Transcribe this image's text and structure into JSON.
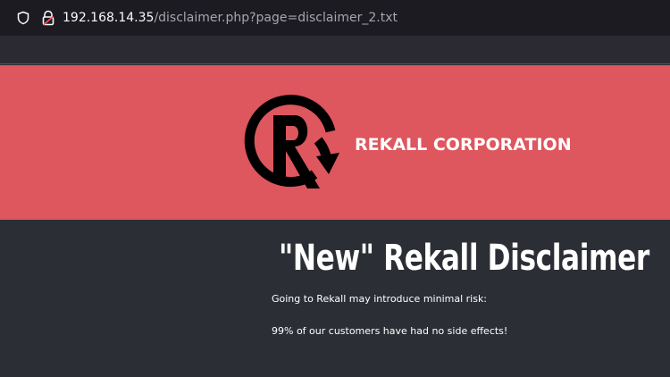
{
  "browser": {
    "url_host": "192.168.14.35",
    "url_path": "/disclaimer.php?page=disclaimer_2.txt",
    "icons": [
      "shield-icon",
      "lock-warning-icon"
    ]
  },
  "header": {
    "brand": "REKALL CORPORATION",
    "logo": "rekall-logo",
    "background_color": "#de565e"
  },
  "main": {
    "title": "\"New\" Rekall Disclaimer",
    "paragraphs": [
      "Going to Rekall may introduce minimal risk:",
      "99% of our customers have had no side effects!"
    ]
  }
}
